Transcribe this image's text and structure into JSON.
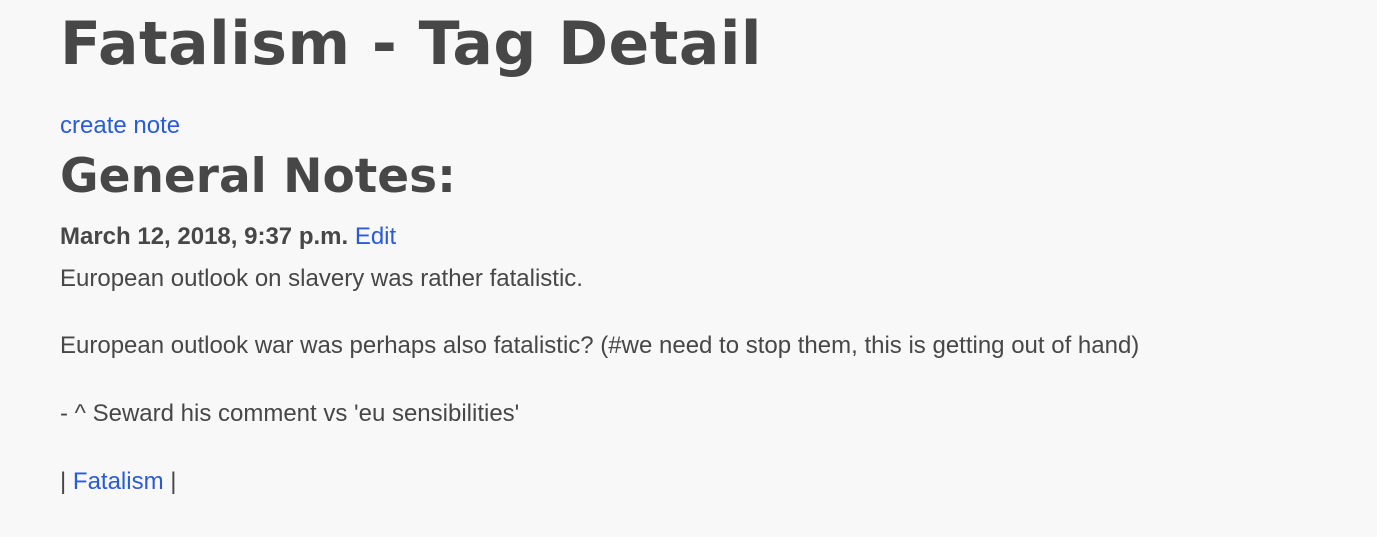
{
  "page": {
    "title": "Fatalism - Tag Detail",
    "create_note_label": "create note",
    "section_title": "General Notes:"
  },
  "notes": [
    {
      "date": "March 12, 2018, 9:37 p.m.",
      "edit_label": "Edit",
      "lines": [
        "European outlook on slavery was rather fatalistic.",
        "European outlook war was perhaps also fatalistic? (#we need to stop them, this is getting out of hand)",
        "- ^ Seward his comment vs 'eu sensibilities'"
      ],
      "tags": {
        "separator": "|",
        "items": [
          "Fatalism"
        ]
      }
    }
  ],
  "colors": {
    "background": "#f8f8f8",
    "text": "#474747",
    "link": "#2a5bd7"
  }
}
